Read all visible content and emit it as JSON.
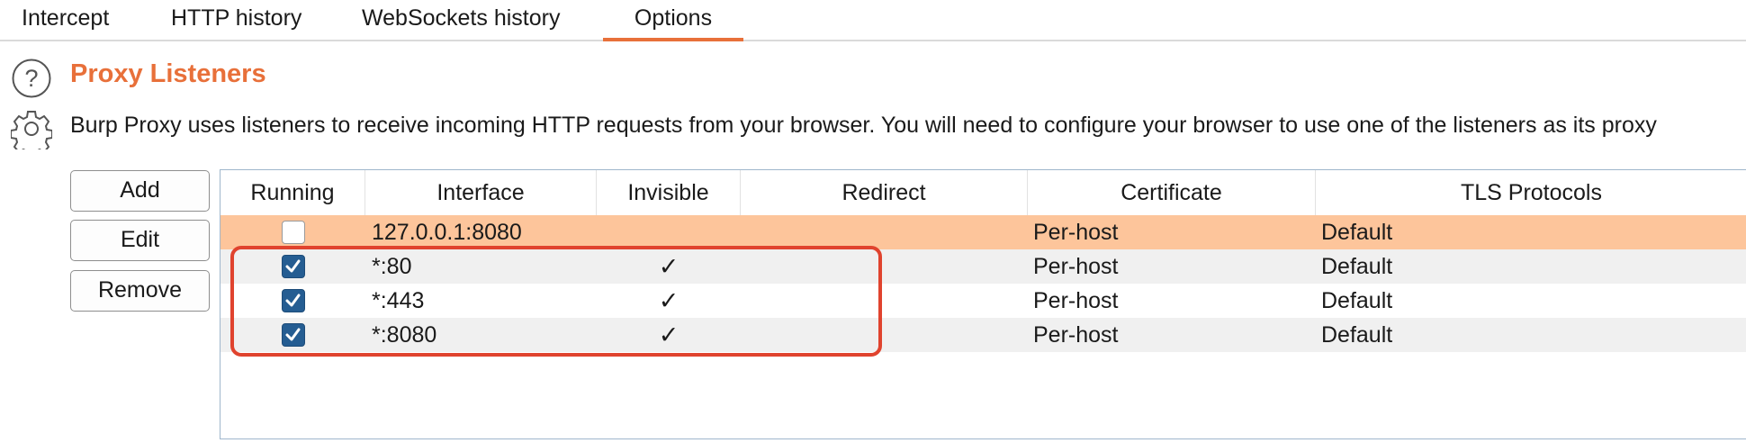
{
  "tabs": [
    {
      "label": "Intercept",
      "active": false
    },
    {
      "label": "HTTP history",
      "active": false
    },
    {
      "label": "WebSockets history",
      "active": false
    },
    {
      "label": "Options",
      "active": true
    }
  ],
  "section": {
    "title": "Proxy Listeners",
    "description": "Burp Proxy uses listeners to receive incoming HTTP requests from your browser. You will need to configure your browser to use one of the listeners as its proxy"
  },
  "buttons": {
    "add": "Add",
    "edit": "Edit",
    "remove": "Remove"
  },
  "table": {
    "columns": [
      "Running",
      "Interface",
      "Invisible",
      "Redirect",
      "Certificate",
      "TLS Protocols"
    ],
    "rows": [
      {
        "running": false,
        "interface": "127.0.0.1:8080",
        "invisible": false,
        "redirect": "",
        "certificate": "Per-host",
        "tls": "Default",
        "selected": true
      },
      {
        "running": true,
        "interface": "*:80",
        "invisible": true,
        "redirect": "",
        "certificate": "Per-host",
        "tls": "Default",
        "selected": false
      },
      {
        "running": true,
        "interface": "*:443",
        "invisible": true,
        "redirect": "",
        "certificate": "Per-host",
        "tls": "Default",
        "selected": false
      },
      {
        "running": true,
        "interface": "*:8080",
        "invisible": true,
        "redirect": "",
        "certificate": "Per-host",
        "tls": "Default",
        "selected": false
      }
    ],
    "invisible_mark": "✓"
  },
  "colors": {
    "accent": "#e8703a",
    "selected_row": "#fdc59b",
    "alt_row": "#f0f0f0",
    "checkbox_checked": "#255d92",
    "annotation": "#e0432e"
  }
}
